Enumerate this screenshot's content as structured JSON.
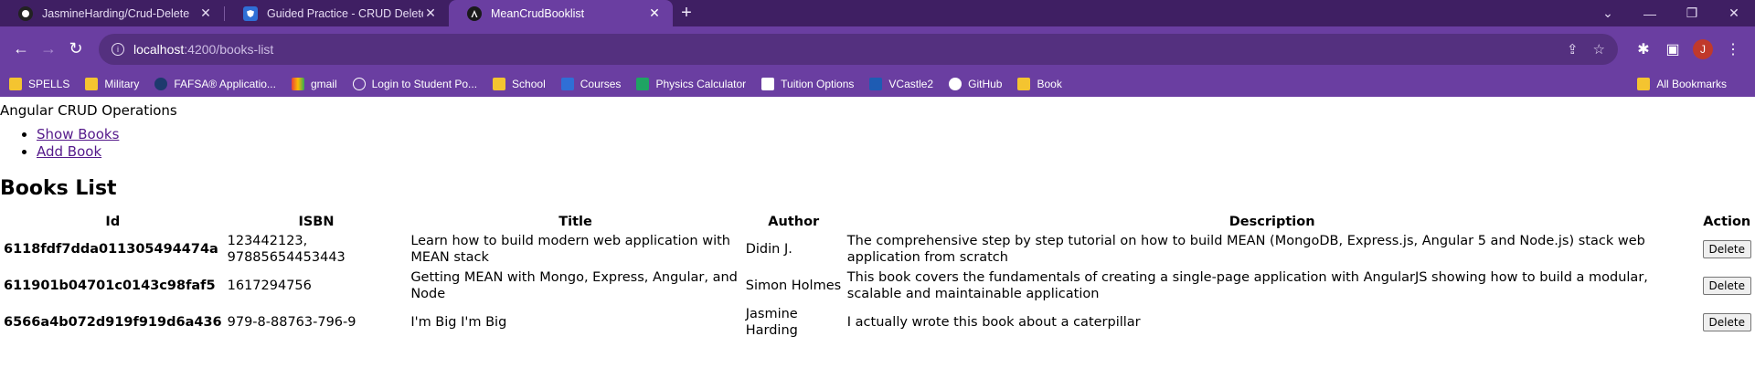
{
  "browser": {
    "tabs": [
      {
        "title": "JasmineHarding/Crud-Delete",
        "icon": "github-icon",
        "active": false
      },
      {
        "title": "Guided Practice - CRUD Delete.p",
        "icon": "shield-icon",
        "active": false
      },
      {
        "title": "MeanCrudBooklist",
        "icon": "angular-icon",
        "active": true
      }
    ],
    "url_host": "localhost",
    "url_path": ":4200/books-list",
    "profile_initial": "J",
    "bookmarks": [
      {
        "label": "SPELLS",
        "icon": "folder-icon"
      },
      {
        "label": "Military",
        "icon": "folder-icon"
      },
      {
        "label": "FAFSA® Applicatio...",
        "icon": "fafsa-icon"
      },
      {
        "label": "gmail",
        "icon": "gmail-icon"
      },
      {
        "label": "Login to Student Po...",
        "icon": "globe-icon"
      },
      {
        "label": "School",
        "icon": "folder-icon"
      },
      {
        "label": "Courses",
        "icon": "shield-icon"
      },
      {
        "label": "Physics Calculator",
        "icon": "check-icon"
      },
      {
        "label": "Tuition Options",
        "icon": "document-icon"
      },
      {
        "label": "VCastle2",
        "icon": "n-icon"
      },
      {
        "label": "GitHub",
        "icon": "github-icon"
      },
      {
        "label": "Book",
        "icon": "folder-icon"
      }
    ],
    "all_bookmarks": "All Bookmarks"
  },
  "app": {
    "title": "Angular CRUD Operations",
    "nav": [
      {
        "label": "Show Books"
      },
      {
        "label": "Add Book"
      }
    ],
    "list_title": "Books List"
  },
  "table": {
    "headers": [
      "Id",
      "ISBN",
      "Title",
      "Author",
      "Description",
      "Action"
    ],
    "rows": [
      {
        "id": "6118fdf7dda011305494474a",
        "isbn": "123442123, 97885654453443",
        "title": "Learn how to build modern web application with MEAN stack",
        "author": "Didin J.",
        "description": "The comprehensive step by step tutorial on how to build MEAN (MongoDB, Express.js, Angular 5 and Node.js) stack web application from scratch",
        "action": "Delete"
      },
      {
        "id": "611901b04701c0143c98faf5",
        "isbn": "1617294756",
        "title": "Getting MEAN with Mongo, Express, Angular, and Node",
        "author": "Simon Holmes",
        "description": "This book covers the fundamentals of creating a single-page application with AngularJS showing how to build a modular, scalable and maintainable application",
        "action": "Delete"
      },
      {
        "id": "6566a4b072d919f919d6a436",
        "isbn": "979-8-88763-796-9",
        "title": "I'm Big I'm Big",
        "author": "Jasmine Harding",
        "description": "I actually wrote this book about a caterpillar",
        "action": "Delete"
      }
    ]
  },
  "colors": {
    "tabbar": "#3f1f63",
    "toolbar": "#6a3ea1",
    "link": "#551a8b"
  }
}
